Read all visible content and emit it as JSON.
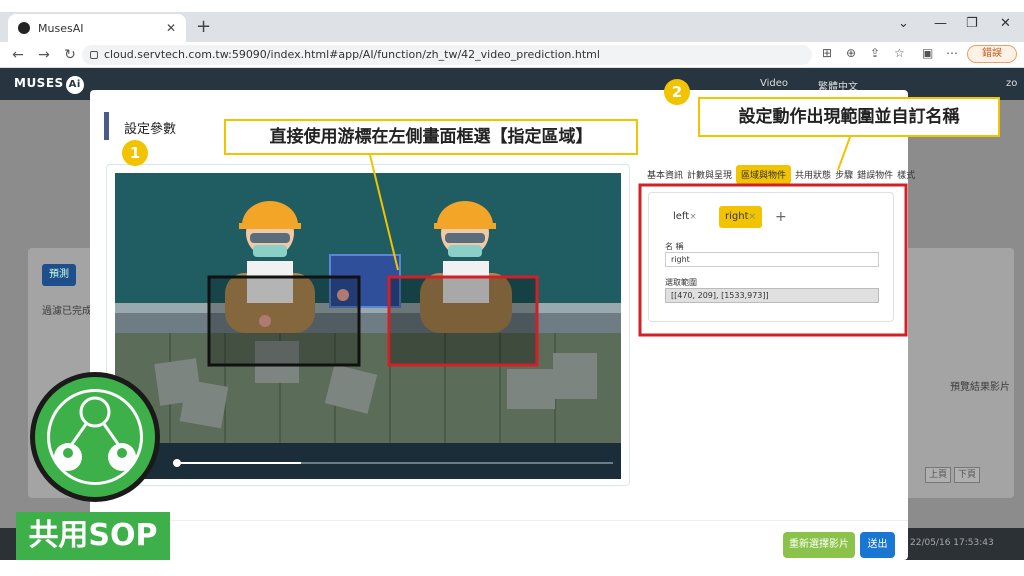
{
  "browser": {
    "tab_title": "MusesAI",
    "tab_close": "✕",
    "new_tab": "+",
    "url": "cloud.servtech.com.tw:59090/index.html#app/AI/function/zh_tw/42_video_prediction.html",
    "error_label": "錯誤",
    "window_controls": [
      "⌄",
      "—",
      "❐",
      "✕"
    ]
  },
  "appbar": {
    "logo": "MUSES",
    "logo_ai": "Ai",
    "video_label": "Video",
    "lang_label": "繁體中文",
    "zoom": "zo"
  },
  "background": {
    "button_label": "預測",
    "filter_text": "過濾已完成",
    "col_header": "預覽結果影片",
    "prev_page": "上頁",
    "next_page": "下頁",
    "timestamp": "22/05/16 17:53:43"
  },
  "modal": {
    "title": "設定參數",
    "tabs": [
      "基本資訊",
      "計數與呈現",
      "區域與物件",
      "共用狀態",
      "步驟",
      "錯誤物件",
      "樣式"
    ],
    "active_tab": "區域與物件",
    "regions": [
      {
        "name": "left",
        "close": "×"
      },
      {
        "name": "right",
        "close": "×"
      }
    ],
    "selected_region": "right",
    "add_label": "+",
    "name_label": "名 稱",
    "name_value": "right",
    "range_label": "選取範圍",
    "range_value": "[[470,  209],  [1533,973]]",
    "reselect_button": "重新選擇影片",
    "submit_button": "送出"
  },
  "annotations": {
    "step1_number": "1",
    "step1_text": "直接使用游標在左側畫面框選【指定區域】",
    "step2_number": "2",
    "step2_text": "設定動作出現範圍並自訂名稱",
    "badge_text": "共用SOP"
  },
  "colors": {
    "accent_yellow": "#f2c300",
    "highlight_red": "#d32027",
    "sop_green": "#3db049",
    "primary_blue": "#1976d2"
  },
  "video": {
    "progress": 0.3
  }
}
